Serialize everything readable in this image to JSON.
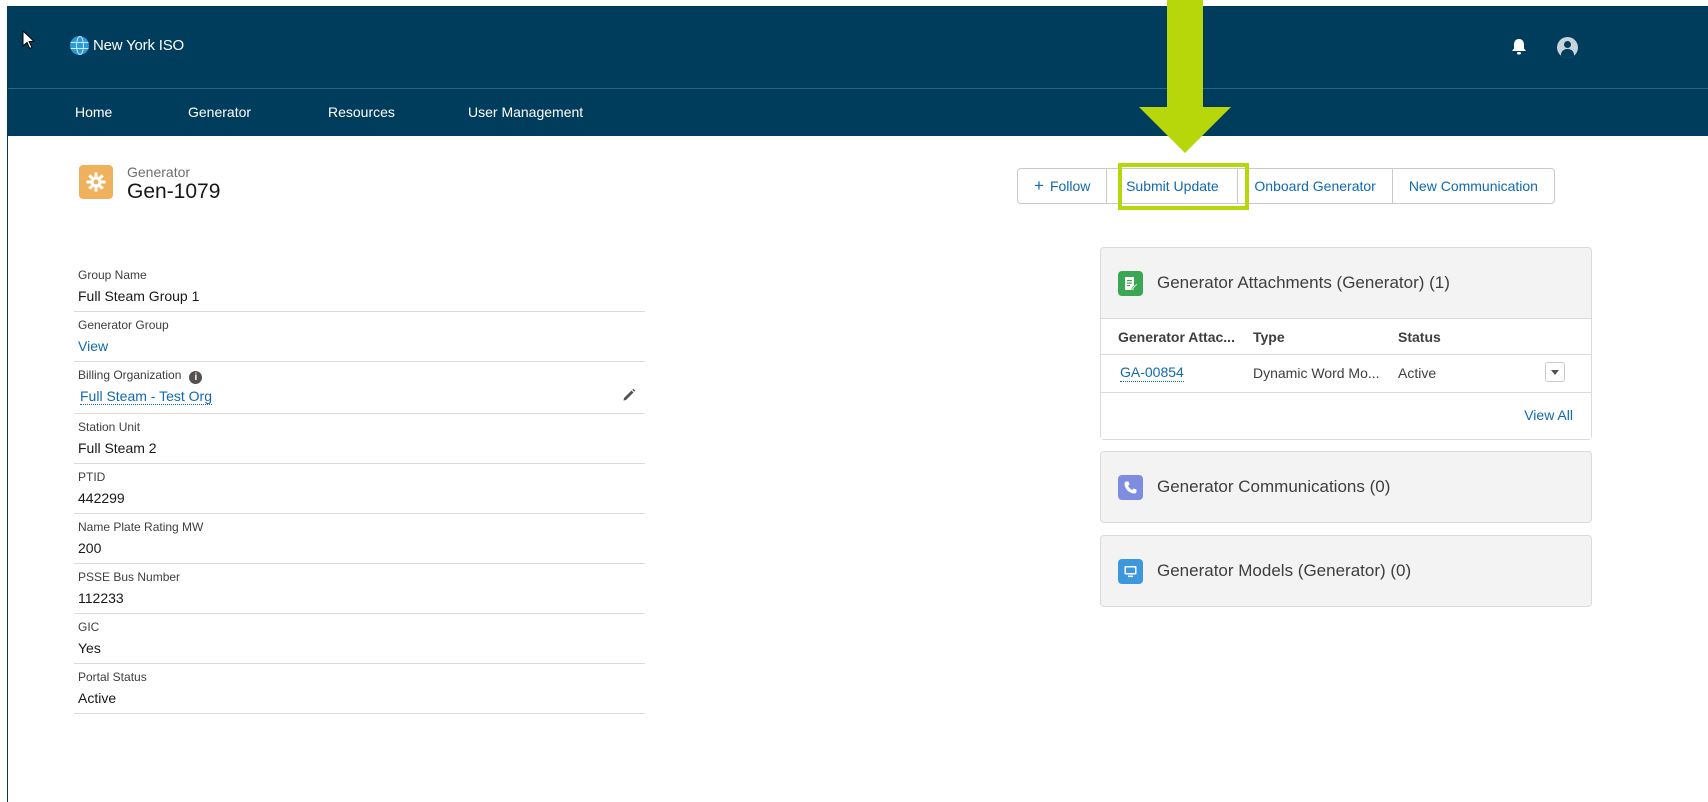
{
  "header": {
    "brand": "New York ISO",
    "nav": [
      "Home",
      "Generator",
      "Resources",
      "User Management"
    ]
  },
  "record": {
    "type": "Generator",
    "title": "Gen-1079",
    "actions": {
      "follow": "Follow",
      "submit_update": "Submit Update",
      "onboard": "Onboard Generator",
      "new_communication": "New Communication"
    }
  },
  "fields": [
    {
      "label": "Group Name",
      "value": "Full Steam Group 1"
    },
    {
      "label": "Generator Group",
      "value": "View"
    },
    {
      "label": "Billing Organization",
      "value": "Full Steam - Test Org"
    },
    {
      "label": "Station Unit",
      "value": "Full Steam 2"
    },
    {
      "label": "PTID",
      "value": "442299"
    },
    {
      "label": "Name Plate Rating MW",
      "value": "200"
    },
    {
      "label": "PSSE Bus Number",
      "value": "112233"
    },
    {
      "label": "GIC",
      "value": "Yes"
    },
    {
      "label": "Portal Status",
      "value": "Active"
    }
  ],
  "related": {
    "attachments": {
      "title": "Generator Attachments (Generator) (1)",
      "columns": [
        "Generator Attac...",
        "Type",
        "Status"
      ],
      "rows": [
        {
          "id": "GA-00854",
          "type": "Dynamic Word Mo...",
          "status": "Active"
        }
      ],
      "view_all": "View All"
    },
    "communications": {
      "title": "Generator Communications (0)"
    },
    "models": {
      "title": "Generator Models (Generator) (0)"
    }
  },
  "colors": {
    "header_bg": "#003d5c",
    "link": "#0f6ab2",
    "highlight": "#b7d70b",
    "record_icon": "#f0b15c"
  }
}
